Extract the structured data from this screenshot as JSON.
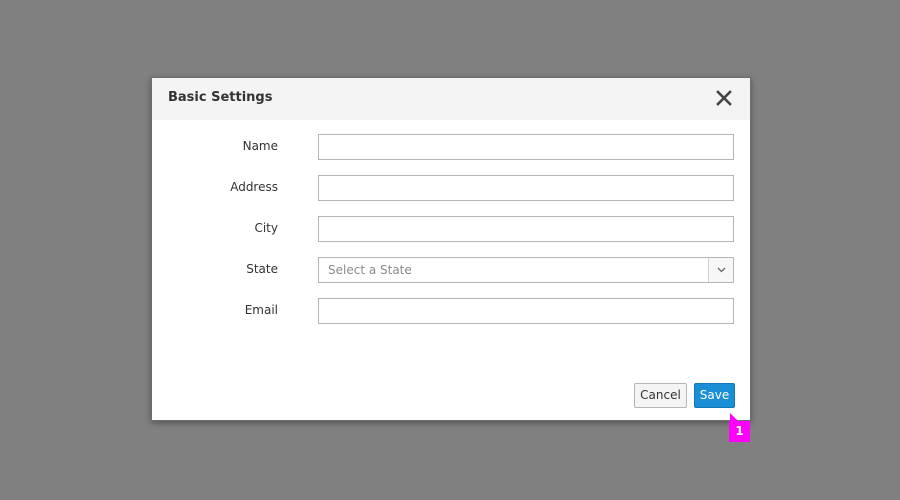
{
  "dialog": {
    "title": "Basic Settings",
    "close_icon": "close-icon"
  },
  "form": {
    "name_label": "Name",
    "name_value": "",
    "address_label": "Address",
    "address_value": "",
    "city_label": "City",
    "city_value": "",
    "state_label": "State",
    "state_placeholder": "Select a State",
    "email_label": "Email",
    "email_value": ""
  },
  "footer": {
    "cancel_label": "Cancel",
    "save_label": "Save"
  },
  "annotation": {
    "badge_text": "1",
    "badge_color": "#ff00ff"
  },
  "colors": {
    "primary": "#1a8fd6",
    "backdrop": "#808080"
  }
}
